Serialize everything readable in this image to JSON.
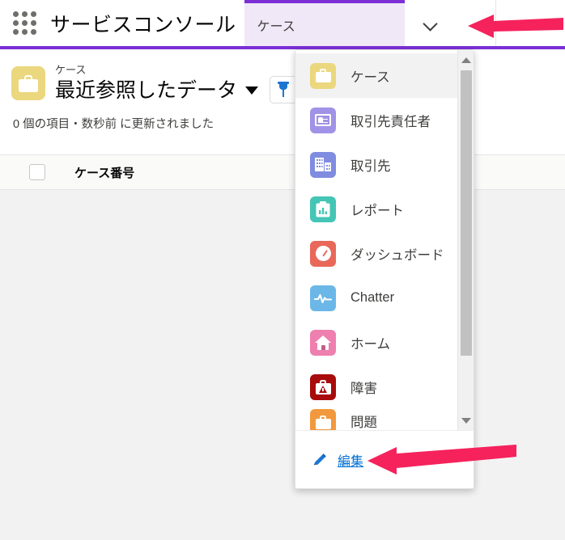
{
  "header": {
    "app_launcher_icon": "waffle-grid-icon",
    "app_name": "サービスコンソール",
    "tab_label": "ケース",
    "chevron_icon": "chevron-down-icon",
    "accent_color": "#7b2fd4"
  },
  "list_header": {
    "object_icon": "case-briefcase-icon",
    "eyebrow": "ケース",
    "title": "最近参照したデータ",
    "caret_icon": "caret-down-icon",
    "pin_icon": "pin-icon",
    "meta": "0 個の項目・数秒前 に更新されました"
  },
  "table": {
    "select_all_icon": "checkbox-icon",
    "columns": [
      "ケース番号"
    ],
    "rows": []
  },
  "dropdown": {
    "items": [
      {
        "label": "ケース",
        "icon": "case-icon",
        "color": "#ebd77e",
        "selected": true
      },
      {
        "label": "取引先責任者",
        "icon": "contact-icon",
        "color": "#a093e7",
        "selected": false
      },
      {
        "label": "取引先",
        "icon": "account-icon",
        "color": "#7f8ce0",
        "selected": false
      },
      {
        "label": "レポート",
        "icon": "report-icon",
        "color": "#45c5b5",
        "selected": false
      },
      {
        "label": "ダッシュボード",
        "icon": "dashboard-icon",
        "color": "#e8685a",
        "selected": false
      },
      {
        "label": "Chatter",
        "icon": "chatter-icon",
        "color": "#6bb7e8",
        "selected": false
      },
      {
        "label": "ホーム",
        "icon": "home-icon",
        "color": "#ee7faf",
        "selected": false
      },
      {
        "label": "障害",
        "icon": "incident-icon",
        "color": "#a80b0b",
        "selected": false
      },
      {
        "label": "問題",
        "icon": "problem-icon",
        "color": "#f2993e",
        "selected": false
      }
    ],
    "scrollbar": {
      "up_icon": "scroll-up-arrow-icon",
      "down_icon": "scroll-down-arrow-icon"
    },
    "footer": {
      "pencil_icon": "pencil-icon",
      "edit_label": "編集"
    }
  },
  "annotations": {
    "arrow_color": "#f5225c",
    "arrows": [
      {
        "name": "arrow-pointing-at-tab-chevron"
      },
      {
        "name": "arrow-pointing-at-edit-link"
      }
    ]
  }
}
